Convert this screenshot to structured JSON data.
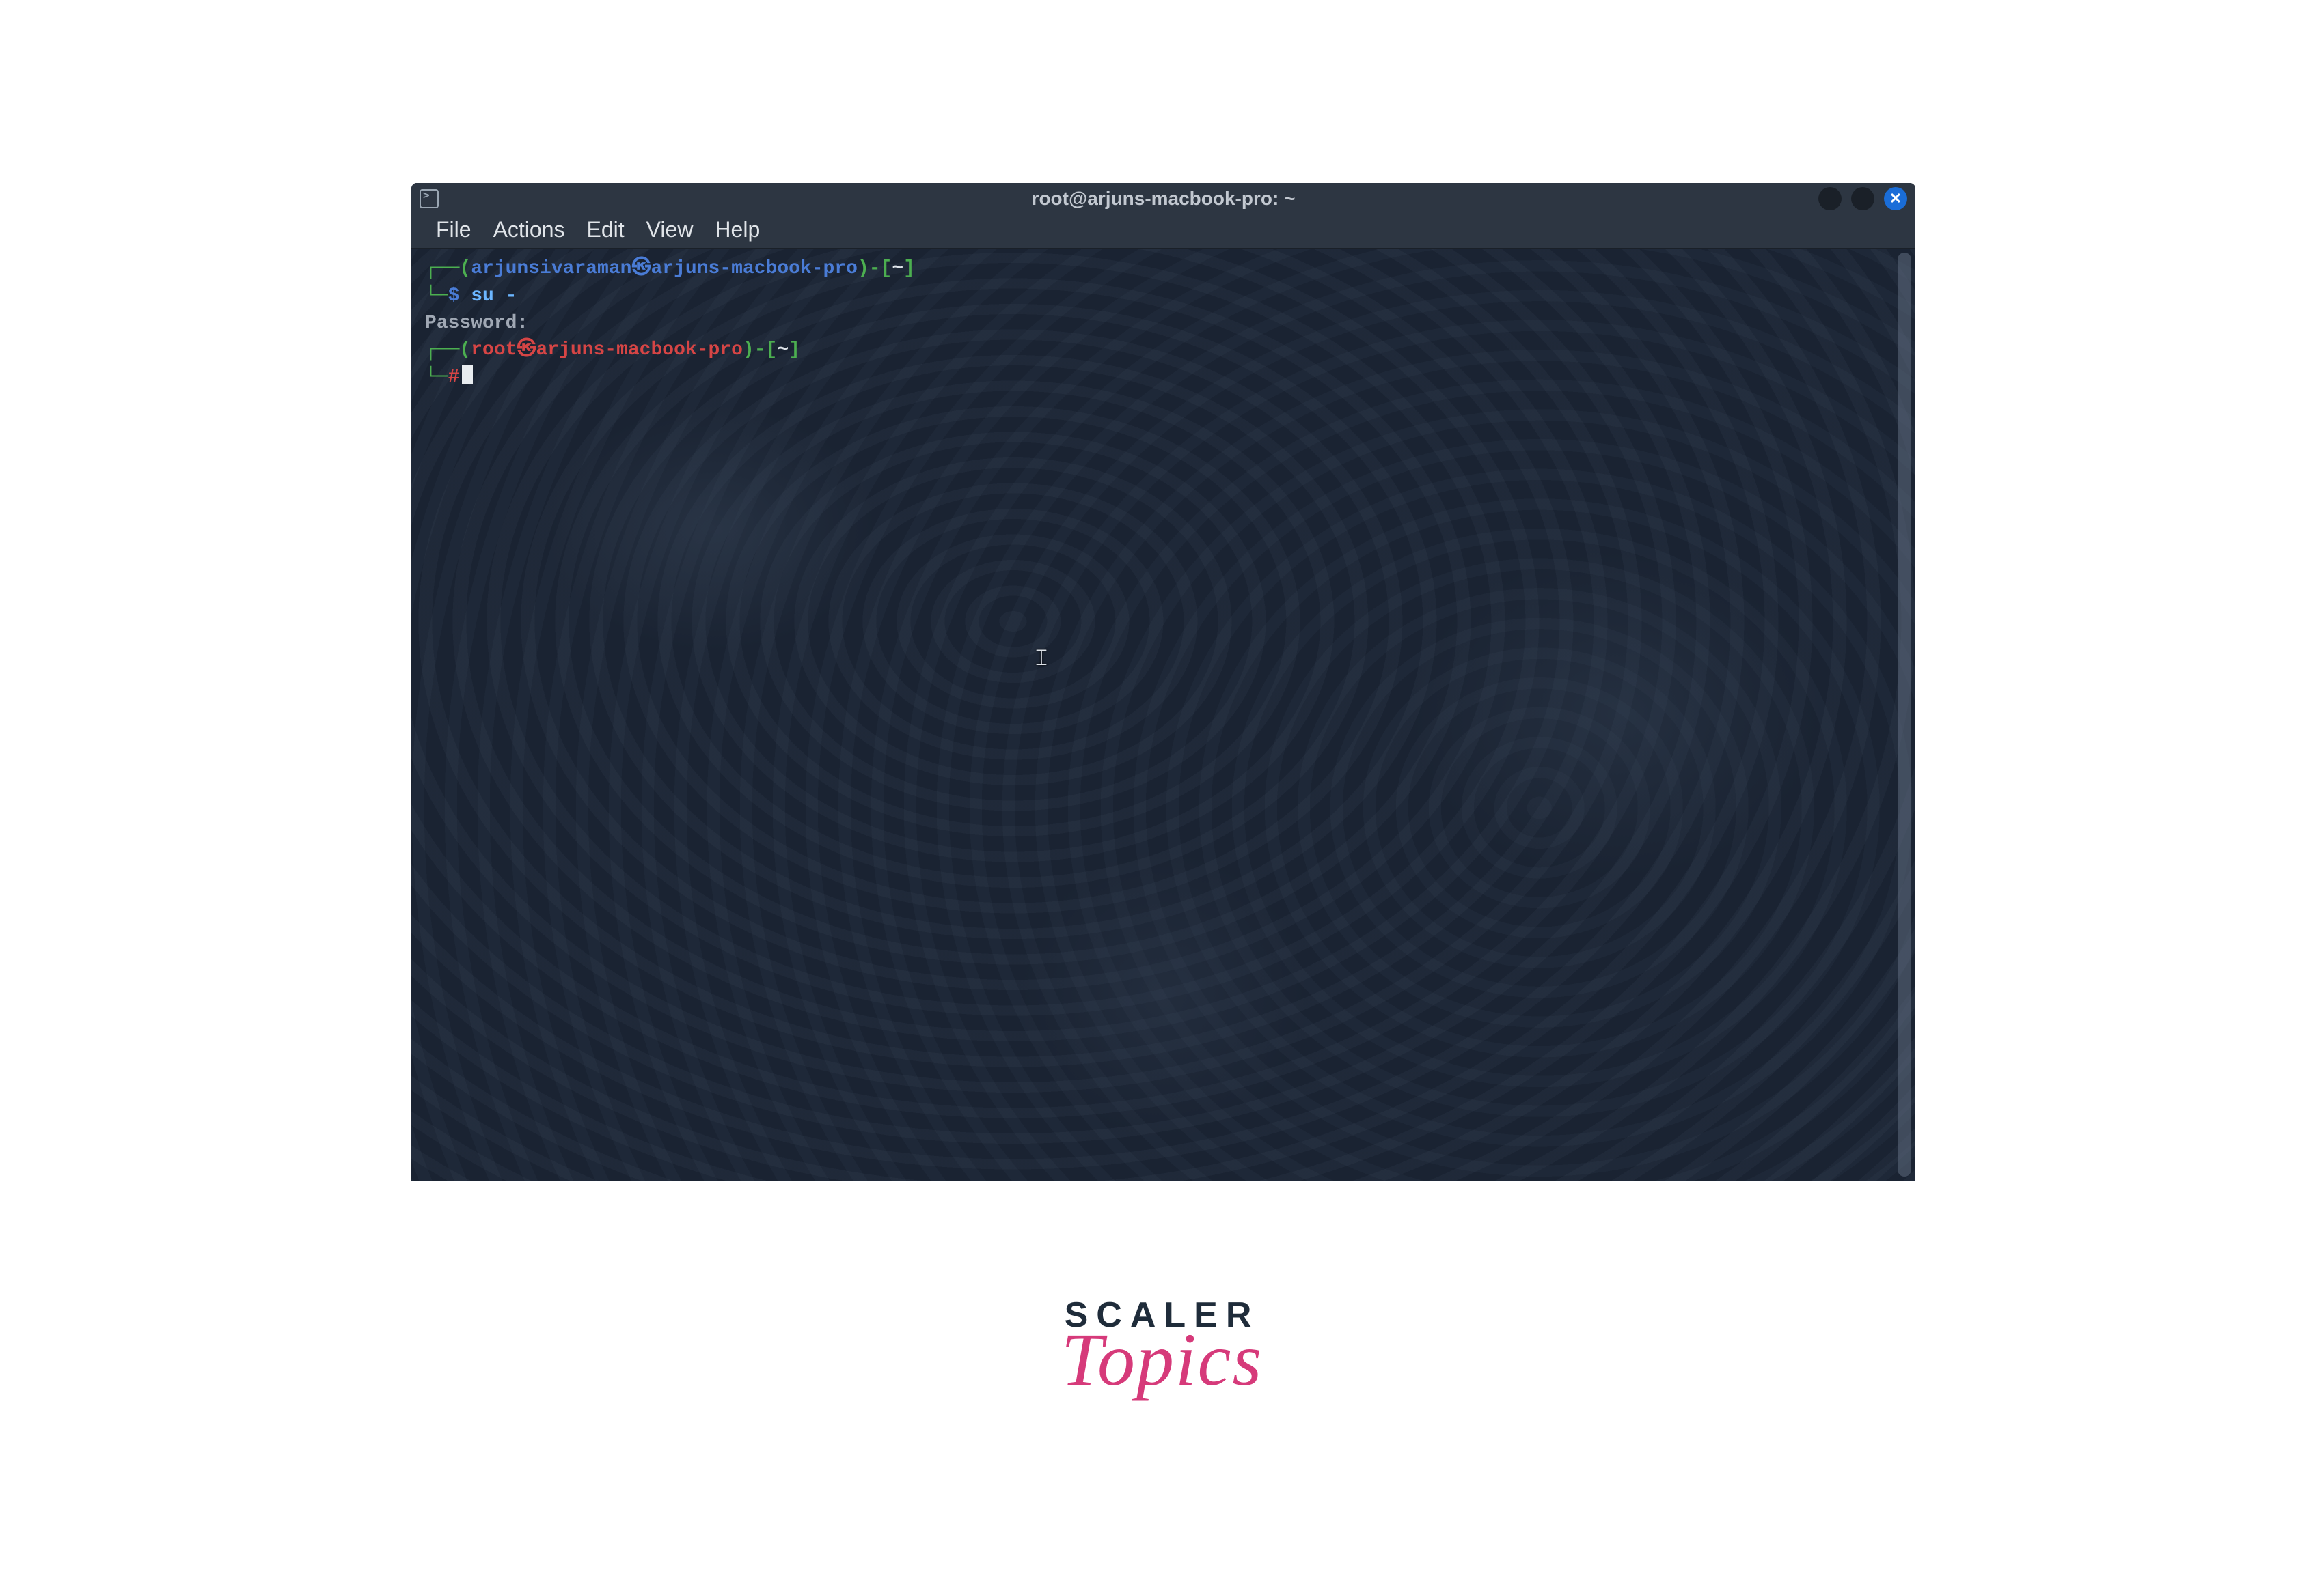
{
  "window": {
    "title": "root@arjuns-macbook-pro: ~"
  },
  "menubar": {
    "items": [
      "File",
      "Actions",
      "Edit",
      "View",
      "Help"
    ]
  },
  "terminal": {
    "line1_user": "arjunsivaraman",
    "line1_at": "㉿",
    "line1_host": "arjuns-macbook-pro",
    "line1_tilde": "~",
    "line2_symbol": "$",
    "line2_cmd": "su -",
    "line3": "Password:",
    "line4_user": "root",
    "line4_at": "㉿",
    "line4_host": "arjuns-macbook-pro",
    "line4_tilde": "~",
    "line5_symbol": "#"
  },
  "branding": {
    "top": "SCALER",
    "bottom": "Topics"
  }
}
